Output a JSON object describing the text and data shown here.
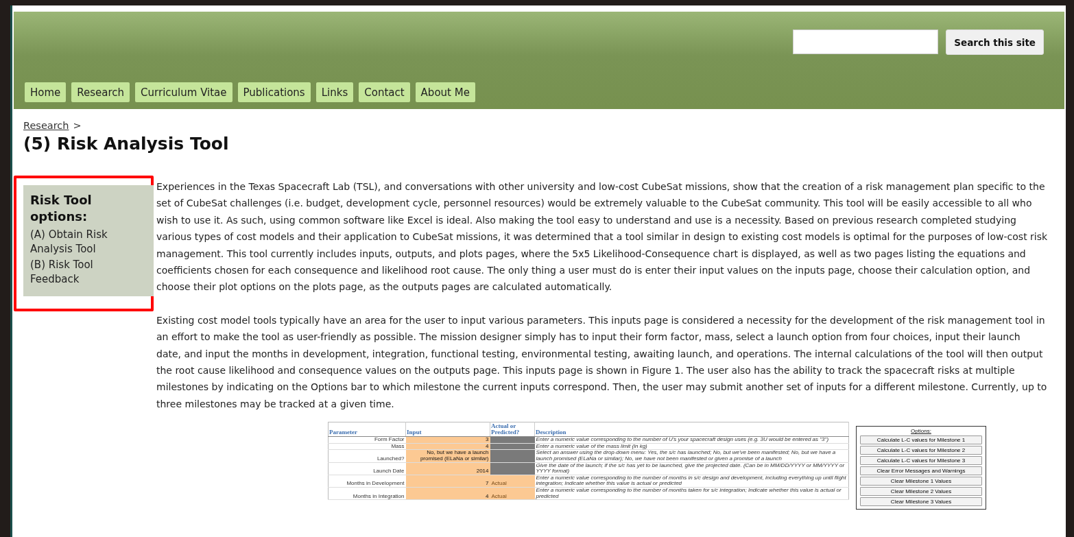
{
  "search": {
    "button": "Search this site"
  },
  "nav": [
    {
      "label": "Home"
    },
    {
      "label": "Research"
    },
    {
      "label": "Curriculum Vitae"
    },
    {
      "label": "Publications"
    },
    {
      "label": "Links"
    },
    {
      "label": "Contact"
    },
    {
      "label": "About Me"
    }
  ],
  "breadcrumb": {
    "link": "Research",
    "separator": ">"
  },
  "title": "(5) Risk Analysis Tool",
  "sidebar": {
    "heading": "Risk Tool options:",
    "links": [
      "(A) Obtain Risk Analysis Tool",
      "(B) Risk Tool Feedback"
    ]
  },
  "paragraphs": [
    "Experiences in the Texas Spacecraft Lab (TSL), and conversations with other university and low-cost CubeSat missions, show that the creation of a risk management plan specific to the set of CubeSat challenges (i.e. budget, development cycle, personnel resources) would be extremely valuable to the CubeSat community. This tool will be easily accessible to all who wish to use it. As such, using common software like Excel is ideal. Also making the tool easy to understand and use is a necessity. Based on previous research completed studying various types of cost models and their application to CubeSat missions, it was determined that a tool similar in design to existing cost models is optimal for the purposes of low-cost risk management. This tool currently includes inputs, outputs, and plots pages, where the 5x5 Likelihood-Consequence chart is displayed, as well as two pages listing the equations and coefficients chosen for each consequence and likelihood root cause. The only thing a user must do is enter their input values on the inputs page, choose their calculation option, and choose their plot options on the plots page, as the outputs pages are calculated automatically.",
    "Existing cost model tools typically have an area for the user to input various parameters. This inputs page is considered a necessity for the development of the risk management tool in an effort to make the tool as user-friendly as possible. The mission designer simply has to input their form factor, mass, select a launch option from four choices, input their launch date, and input the months in development, integration, functional testing, environmental testing, awaiting launch, and operations. The internal calculations of the tool will then output the root cause likelihood and consequence values on the outputs page. This inputs page is shown in Figure 1. The user also has the ability to track the spacecraft risks at multiple milestones by indicating on the Options bar to which milestone the current inputs correspond. Then, the user may submit another set of inputs for a different milestone. Currently, up to three milestones may be tracked at a given time."
  ],
  "figure": {
    "columns": [
      "Parameter",
      "Input",
      "Actual or Predicted?",
      "Description"
    ],
    "rows": [
      {
        "parameter": "Form Factor",
        "input": "3",
        "description": "Enter a numeric value corresponding to the number of U's your spacecraft design uses (e.g. 3U would be entered as \"3\")"
      },
      {
        "parameter": "Mass",
        "input": "4",
        "description": "Enter a numeric value of the mass limit (in kg)"
      },
      {
        "parameter": "Launched?",
        "input": "No, but we have a launch promised (ELaNa or similar)",
        "description": "Select an answer using the drop-down menu: Yes, the s/c has launched; No, but we've been manifested; No, but we have a launch promised (ELaNa or similar); No, we have not been manifested or given a promise of a launch"
      },
      {
        "parameter": "Launch Date",
        "input": "2014",
        "description": "Give the date of the launch; if the s/c has yet to be launched, give the projected date. (Can be in MM/DD/YYYY or MM/YYYY or YYYY format)"
      },
      {
        "parameter": "Months in Development",
        "input": "7",
        "status": "Actual",
        "description": "Enter a numeric value corresponding to the number of months in s/c design and development, including everything up until flight integration; Indicate whether this value is actual or predicted"
      },
      {
        "parameter": "Months in Integration",
        "input": "4",
        "status": "Actual",
        "description": "Enter a numeric value corresponding to the number of months taken for s/c integration; Indicate whether this value is actual or predicted"
      }
    ],
    "options": {
      "title": "Options:",
      "buttons": [
        "Calculate L-C values for Milestone 1",
        "Calculate L-C values for Milestone 2",
        "Calculate L-C values for Milestone 3",
        "Clear Error Messages and Warnings",
        "Clear Milestone 1 Values",
        "Clear Milestone 2 Values",
        "Clear Milestone 3 Values"
      ]
    }
  }
}
